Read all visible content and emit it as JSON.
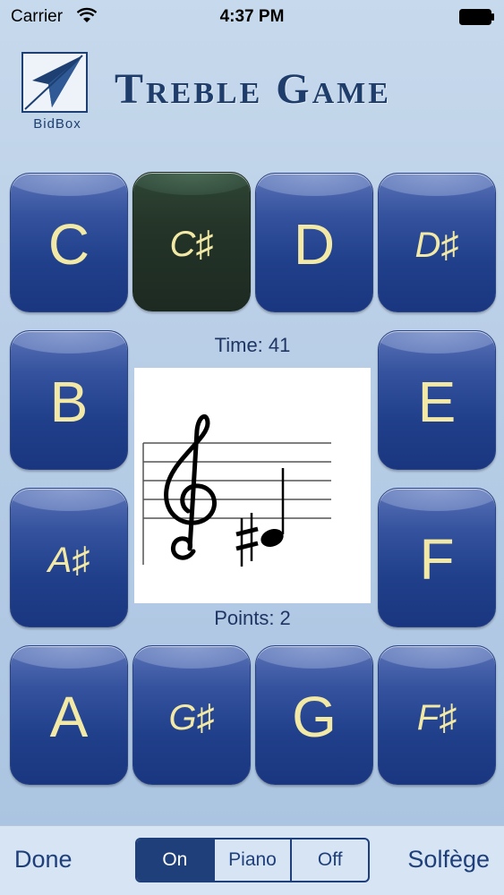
{
  "status_bar": {
    "carrier": "Carrier",
    "time": "4:37 PM"
  },
  "header": {
    "logo_text": "BidBox",
    "title": "Treble Game"
  },
  "notes": [
    {
      "label": "C",
      "sharp": false,
      "selected": false
    },
    {
      "label": "C♯",
      "sharp": true,
      "selected": true
    },
    {
      "label": "D",
      "sharp": false,
      "selected": false
    },
    {
      "label": "D♯",
      "sharp": true,
      "selected": false
    },
    {
      "label": "B",
      "sharp": false,
      "selected": false
    },
    {
      "label": "E",
      "sharp": false,
      "selected": false
    },
    {
      "label": "A♯",
      "sharp": true,
      "selected": false
    },
    {
      "label": "F",
      "sharp": false,
      "selected": false
    },
    {
      "label": "A",
      "sharp": false,
      "selected": false
    },
    {
      "label": "G♯",
      "sharp": true,
      "selected": false
    },
    {
      "label": "G",
      "sharp": false,
      "selected": false
    },
    {
      "label": "F♯",
      "sharp": true,
      "selected": false
    }
  ],
  "game": {
    "time": "Time: 41",
    "points": "Points: 2"
  },
  "staff": {
    "clef": "treble",
    "accidental": "sharp"
  },
  "toolbar": {
    "done": "Done",
    "segments": [
      "On",
      "Piano",
      "Off"
    ],
    "active_segment": "On",
    "solfege": "Solfège"
  },
  "colors": {
    "button_blue": "#203f8a",
    "button_selected": "#243428",
    "note_text": "#f2e9a6",
    "accent": "#1f3f7a"
  }
}
